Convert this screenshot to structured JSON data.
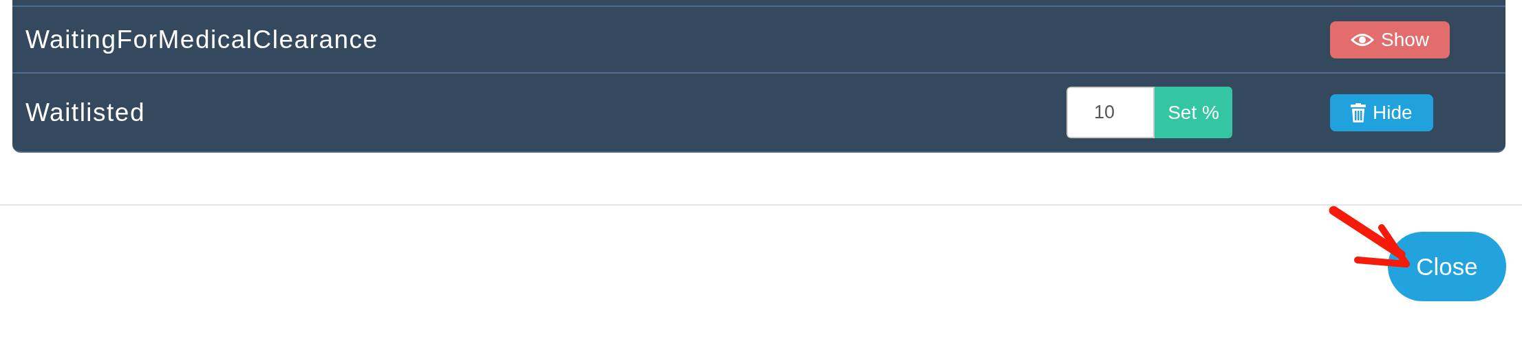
{
  "rows": [
    {
      "name": "WaitingForMedicalClearance",
      "toggle": {
        "kind": "show",
        "label": "Show"
      }
    },
    {
      "name": "Waitlisted",
      "percent": {
        "value": "10",
        "button": "Set %"
      },
      "toggle": {
        "kind": "hide",
        "label": "Hide"
      }
    }
  ],
  "footer": {
    "close": "Close",
    "arrow_annotation": true
  }
}
